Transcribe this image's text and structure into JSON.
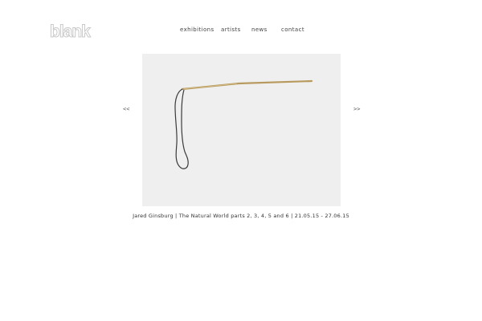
{
  "header": {
    "logo_text": "blank"
  },
  "nav": {
    "items": [
      {
        "label": "exhibitions"
      },
      {
        "label": "artists"
      },
      {
        "label": "news"
      },
      {
        "label": "contact"
      }
    ]
  },
  "slideshow": {
    "prev_label": "<<",
    "next_label": ">>",
    "caption": "Jared Ginsburg | The Natural World parts 2, 3, 4, 5 and 6 | 21.05.15 - 27.06.15"
  },
  "colors": {
    "background": "#ffffff",
    "artwork_background": "#efefef",
    "stick": "#b89a5e",
    "cord": "#3a3a3a"
  }
}
